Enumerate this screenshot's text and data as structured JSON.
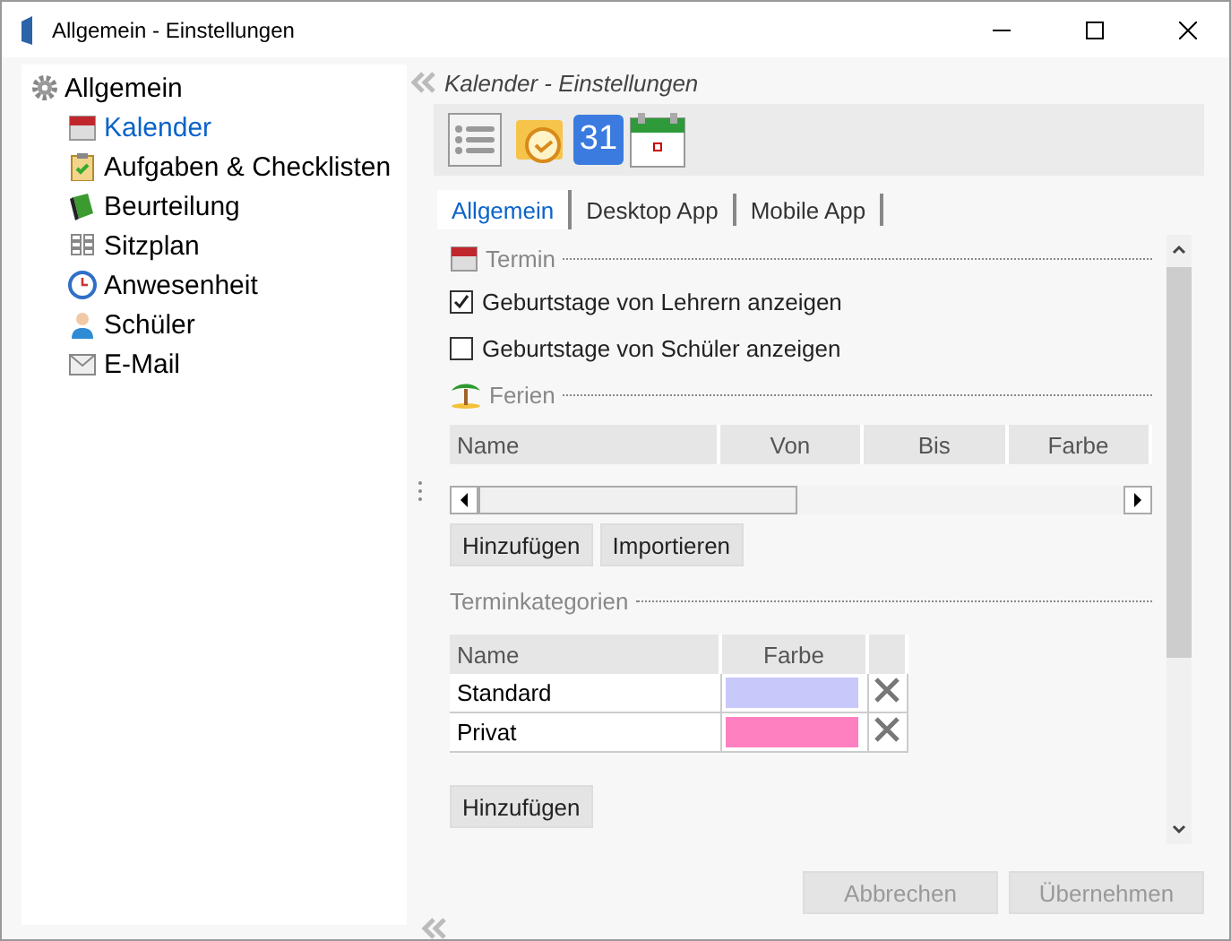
{
  "window": {
    "title": "Allgemein - Einstellungen"
  },
  "sidebar": {
    "root": {
      "label": "Allgemein"
    },
    "items": [
      {
        "label": "Kalender",
        "selected": true
      },
      {
        "label": "Aufgaben & Checklisten",
        "selected": false
      },
      {
        "label": "Beurteilung",
        "selected": false
      },
      {
        "label": "Sitzplan",
        "selected": false
      },
      {
        "label": "Anwesenheit",
        "selected": false
      },
      {
        "label": "Schüler",
        "selected": false
      },
      {
        "label": "E-Mail",
        "selected": false
      }
    ]
  },
  "panel": {
    "title": "Kalender - Einstellungen",
    "toolbar": [
      {
        "kind": "list"
      },
      {
        "kind": "mail"
      },
      {
        "kind": "date",
        "label": "31"
      },
      {
        "kind": "calendar"
      }
    ],
    "tabs": [
      {
        "label": "Allgemein",
        "selected": true
      },
      {
        "label": "Desktop App",
        "selected": false
      },
      {
        "label": "Mobile App",
        "selected": false
      }
    ],
    "termin": {
      "title": "Termin",
      "options": [
        {
          "label": "Geburtstage von Lehrern anzeigen",
          "checked": true
        },
        {
          "label": "Geburtstage von Schüler anzeigen",
          "checked": false
        }
      ]
    },
    "ferien": {
      "title": "Ferien",
      "columns": [
        "Name",
        "Von",
        "Bis",
        "Farbe"
      ],
      "buttons": [
        "Hinzufügen",
        "Importieren"
      ]
    },
    "categories": {
      "title": "Terminkategorien",
      "columns": [
        "Name",
        "Farbe"
      ],
      "rows": [
        {
          "name": "Standard",
          "color": "#c8c8fa"
        },
        {
          "name": "Privat",
          "color": "#ff80c0"
        }
      ],
      "button": "Hinzufügen"
    },
    "footer": [
      {
        "label": "Abbrechen",
        "disabled": true
      },
      {
        "label": "Übernehmen",
        "disabled": true
      }
    ]
  }
}
